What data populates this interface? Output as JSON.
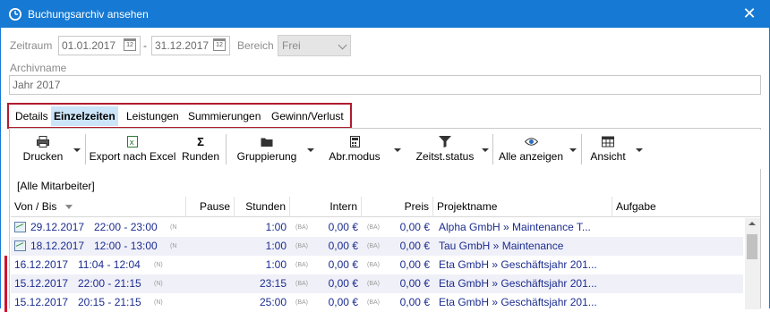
{
  "window": {
    "title": "Buchungsarchiv ansehen",
    "close_glyph": "✕"
  },
  "filter": {
    "zeitraum_label": "Zeitraum",
    "date_from": "01.01.2017",
    "date_sep": "-",
    "date_to": "31.12.2017",
    "bereich_label": "Bereich",
    "bereich_value": "Frei",
    "archivname_label": "Archivname",
    "archivname_value": "Jahr 2017",
    "cal_glyph": "12"
  },
  "tabs": [
    {
      "label": "Details"
    },
    {
      "label": "Einzelzeiten",
      "active": true
    },
    {
      "label": "Leistungen"
    },
    {
      "label": "Summierungen"
    },
    {
      "label": "Gewinn/Verlust"
    }
  ],
  "toolbar": {
    "drucken": "Drucken",
    "export": "Export nach Excel",
    "runden": "Runden",
    "gruppierung": "Gruppierung",
    "abrmodus": "Abr.modus",
    "zeitstatus": "Zeitst.status",
    "alle": "Alle anzeigen",
    "ansicht": "Ansicht",
    "runden_glyph": "Σ"
  },
  "group_label": "[Alle Mitarbeiter]",
  "grid": {
    "headers": {
      "vonbis": "Von / Bis",
      "pause": "Pause",
      "stunden": "Stunden",
      "intern": "Intern",
      "preis": "Preis",
      "projekt": "Projektname",
      "aufgabe": "Aufgabe"
    },
    "rows": [
      {
        "date": "29.12.2017",
        "time": "22:00 - 23:00",
        "flag": "(N",
        "stunden": "1:00",
        "ba1": "(BA)",
        "intern": "0,00 €",
        "ba2": "(BA)",
        "preis": "0,00 €",
        "projekt": "Alpha GmbH » Maintenance T...",
        "icon": "chart-icon"
      },
      {
        "date": "18.12.2017",
        "time": "12:00 - 13:00",
        "flag": "(N",
        "stunden": "1:00",
        "ba1": "(BA)",
        "intern": "0,00 €",
        "ba2": "(BA)",
        "preis": "0,00 €",
        "projekt": "Tau GmbH » Maintenance",
        "icon": "chart-icon"
      },
      {
        "date": "16.12.2017",
        "time": "11:04 - 12:04",
        "flag": "(N)",
        "stunden": "1:00",
        "ba1": "(BA)",
        "intern": "0,00 €",
        "ba2": "(BA)",
        "preis": "0,00 €",
        "projekt": "Eta GmbH » Geschäftsjahr 201...",
        "marker": "#d0142c"
      },
      {
        "date": "15.12.2017",
        "time": "22:00 - 21:15",
        "flag": "(N)",
        "stunden": "23:15",
        "ba1": "(BA)",
        "intern": "0,00 €",
        "ba2": "(BA)",
        "preis": "0,00 €",
        "projekt": "Eta GmbH » Geschäftsjahr 201...",
        "marker": "#d0142c"
      },
      {
        "date": "15.12.2017",
        "time": "20:15 - 21:15",
        "flag": "(N)",
        "stunden": "25:00",
        "ba1": "(BA)",
        "intern": "0,00 €",
        "ba2": "(BA)",
        "preis": "0,00 €",
        "projekt": "Eta GmbH » Geschäftsjahr 201...",
        "marker": "#d0142c"
      }
    ]
  },
  "colors": {
    "titlebar": "#1679d3",
    "highlight": "#b01c2e",
    "link": "#1b2d8f",
    "marker": "#d0142c",
    "tab_active": "#cce4f7"
  }
}
